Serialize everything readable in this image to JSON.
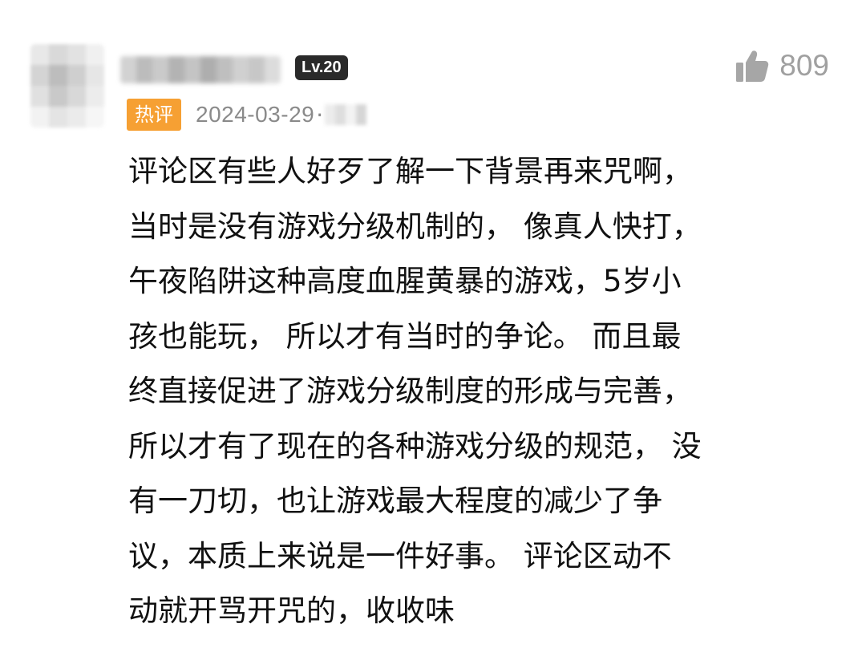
{
  "comment": {
    "level_badge": "Lv.20",
    "likes": {
      "icon": "thumbs-up-icon",
      "count": "809"
    },
    "meta": {
      "hot_badge": "热评",
      "date": "2024-03-29",
      "separator": "·"
    },
    "body_lines": [
      "评论区有些人好歹了解一下背景再来咒啊，",
      "当时是没有游戏分级机制的， 像真人快打，",
      "午夜陷阱这种高度血腥黄暴的游戏，5岁小",
      "孩也能玩， 所以才有当时的争论。 而且最",
      "终直接促进了游戏分级制度的形成与完善，",
      "所以才有了现在的各种游戏分级的规范， 没",
      "有一刀切，也让游戏最大程度的减少了争",
      "议，本质上来说是一件好事。 评论区动不",
      "动就开骂开咒的，收收味"
    ],
    "colors": {
      "hot_badge_bg": "#f6a033",
      "level_badge_bg": "#2a2a2a",
      "meta_text": "#8a8a8a",
      "like_color": "#a6a6a6"
    }
  }
}
